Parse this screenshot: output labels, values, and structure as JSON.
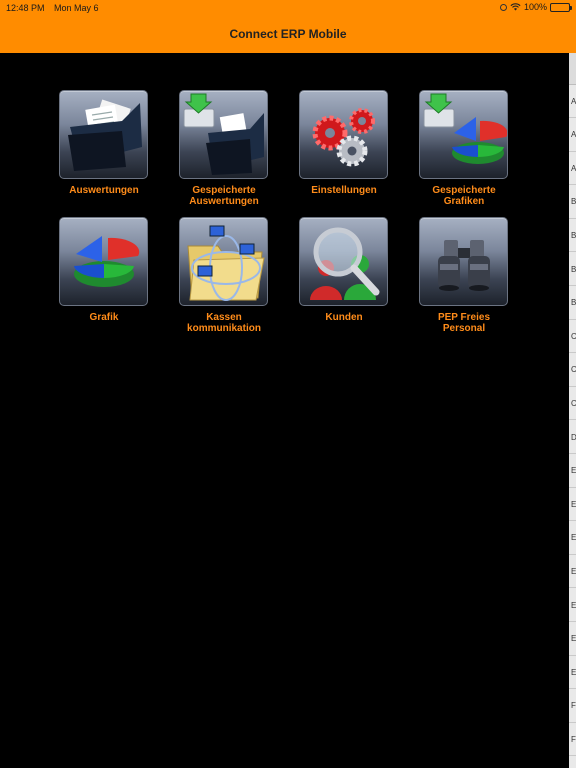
{
  "status_bar": {
    "time": "12:48 PM",
    "date": "Mon May 6",
    "battery": "100%",
    "battery_level": 1.0
  },
  "nav": {
    "title": "Connect ERP Mobile"
  },
  "tiles": [
    {
      "id": "auswertungen",
      "label_lines": [
        "Auswertungen"
      ],
      "icon": "folder-documents-icon"
    },
    {
      "id": "gespeicherte-auswertungen",
      "label_lines": [
        "Gespeicherte",
        "Auswertungen"
      ],
      "icon": "saved-folder-icon"
    },
    {
      "id": "einstellungen",
      "label_lines": [
        "Einstellungen"
      ],
      "icon": "gears-icon"
    },
    {
      "id": "gespeicherte-grafiken",
      "label_lines": [
        "Gespeicherte",
        "Grafiken"
      ],
      "icon": "saved-chart-icon"
    },
    {
      "id": "grafik",
      "label_lines": [
        "Grafik"
      ],
      "icon": "pie-chart-icon"
    },
    {
      "id": "kassen-kommunikation",
      "label_lines": [
        "Kassen",
        "kommunikation"
      ],
      "icon": "network-folder-icon"
    },
    {
      "id": "kunden",
      "label_lines": [
        "Kunden"
      ],
      "icon": "customer-search-icon"
    },
    {
      "id": "pep-freies-personal",
      "label_lines": [
        "PEP Freies",
        "Personal"
      ],
      "icon": "binoculars-icon"
    }
  ],
  "index_bar": [
    "A",
    "A",
    "A",
    "B",
    "B",
    "B",
    "B",
    "C",
    "C",
    "C",
    "D",
    "E",
    "E",
    "E",
    "E",
    "E",
    "E",
    "E",
    "F",
    "F"
  ],
  "colors": {
    "accent": "#ff8c00",
    "label": "#ff8c1a",
    "background": "#000000"
  }
}
